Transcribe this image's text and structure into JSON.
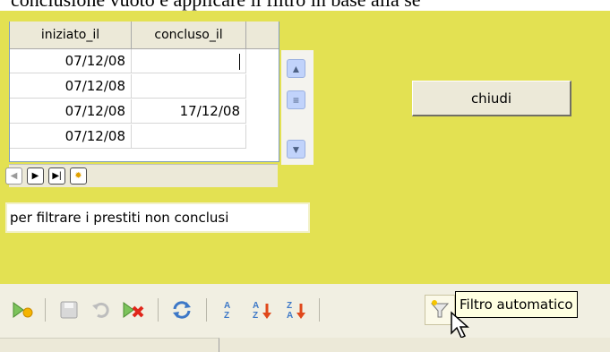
{
  "doc_text": "conclusione vuoto e applicare il filtro in base alla se",
  "table": {
    "headers": [
      "iniziato_il",
      "concluso_il"
    ],
    "rows": [
      [
        "07/12/08",
        ""
      ],
      [
        "07/12/08",
        ""
      ],
      [
        "07/12/08",
        "17/12/08"
      ],
      [
        "07/12/08",
        ""
      ]
    ]
  },
  "close_button": "chiudi",
  "hint_text": "per filtrare i prestiti non conclusi",
  "toolbar": {
    "tooltip": "Filtro automatico",
    "icons": [
      "new-record-icon",
      "save-icon",
      "undo-icon",
      "delete-record-icon",
      "refresh-icon",
      "sort-icon",
      "sort-ascending-icon",
      "sort-descending-icon",
      "autofilter-icon"
    ]
  },
  "colors": {
    "form_background": "#e3e152",
    "tooltip_background": "#ffffe1"
  }
}
